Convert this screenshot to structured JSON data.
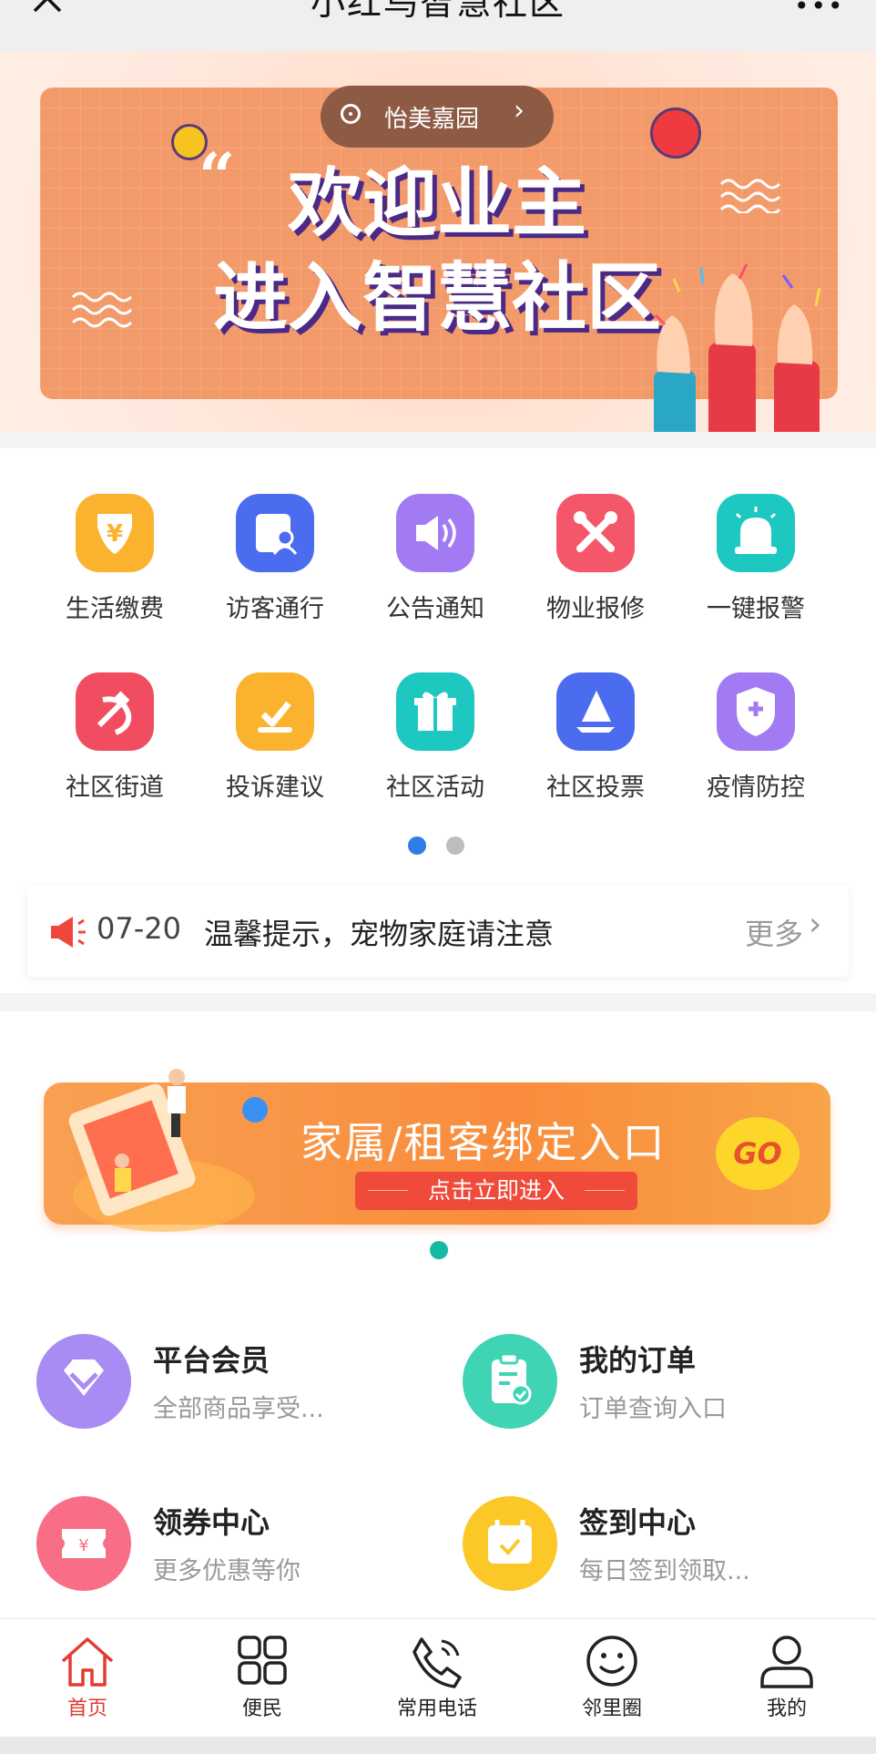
{
  "header": {
    "title": "小红鸟智慧社区"
  },
  "banner": {
    "location": "怡美嘉园",
    "headline_line1": "欢迎业主",
    "headline_line2": "进入智慧社区"
  },
  "grid": {
    "items": [
      {
        "label": "生活缴费",
        "icon": "wallet-yuan-icon",
        "color": "#fbb22e"
      },
      {
        "label": "访客通行",
        "icon": "visitor-pass-icon",
        "color": "#4c6cf0"
      },
      {
        "label": "公告通知",
        "icon": "speaker-icon",
        "color": "#a27af4"
      },
      {
        "label": "物业报修",
        "icon": "repair-tools-icon",
        "color": "#f4566a"
      },
      {
        "label": "一键报警",
        "icon": "alarm-siren-icon",
        "color": "#1cc8c0"
      },
      {
        "label": "社区街道",
        "icon": "hammer-sickle-icon",
        "color": "#f04e60"
      },
      {
        "label": "投诉建议",
        "icon": "complaint-check-icon",
        "color": "#fbb22e"
      },
      {
        "label": "社区活动",
        "icon": "gift-box-icon",
        "color": "#1cc8c0"
      },
      {
        "label": "社区投票",
        "icon": "vote-ship-icon",
        "color": "#4c6cf0"
      },
      {
        "label": "疫情防控",
        "icon": "medical-shield-icon",
        "color": "#a27af4"
      }
    ]
  },
  "notice": {
    "date": "07-20",
    "text": "温馨提示，宠物家庭请注意",
    "more": "更多"
  },
  "promo": {
    "title": "家属/租客绑定入口",
    "button": "点击立即进入",
    "go": "GO"
  },
  "services": [
    {
      "title": "平台会员",
      "subtitle": "全部商品享受...",
      "icon": "diamond-icon",
      "color": "#a88bf3"
    },
    {
      "title": "我的订单",
      "subtitle": "订单查询入口",
      "icon": "clipboard-check-icon",
      "color": "#3fd4b4"
    },
    {
      "title": "领券中心",
      "subtitle": "更多优惠等你",
      "icon": "coupon-icon",
      "color": "#f76e86"
    },
    {
      "title": "签到中心",
      "subtitle": "每日签到领取...",
      "icon": "calendar-check-icon",
      "color": "#fbc828"
    }
  ],
  "tabbar": {
    "items": [
      {
        "label": "首页",
        "icon": "home-icon",
        "active": true
      },
      {
        "label": "便民",
        "icon": "grid-icon",
        "active": false
      },
      {
        "label": "常用电话",
        "icon": "phone-icon",
        "active": false
      },
      {
        "label": "邻里圈",
        "icon": "smiley-icon",
        "active": false
      },
      {
        "label": "我的",
        "icon": "user-icon",
        "active": false
      }
    ],
    "active_color": "#e43a31"
  }
}
